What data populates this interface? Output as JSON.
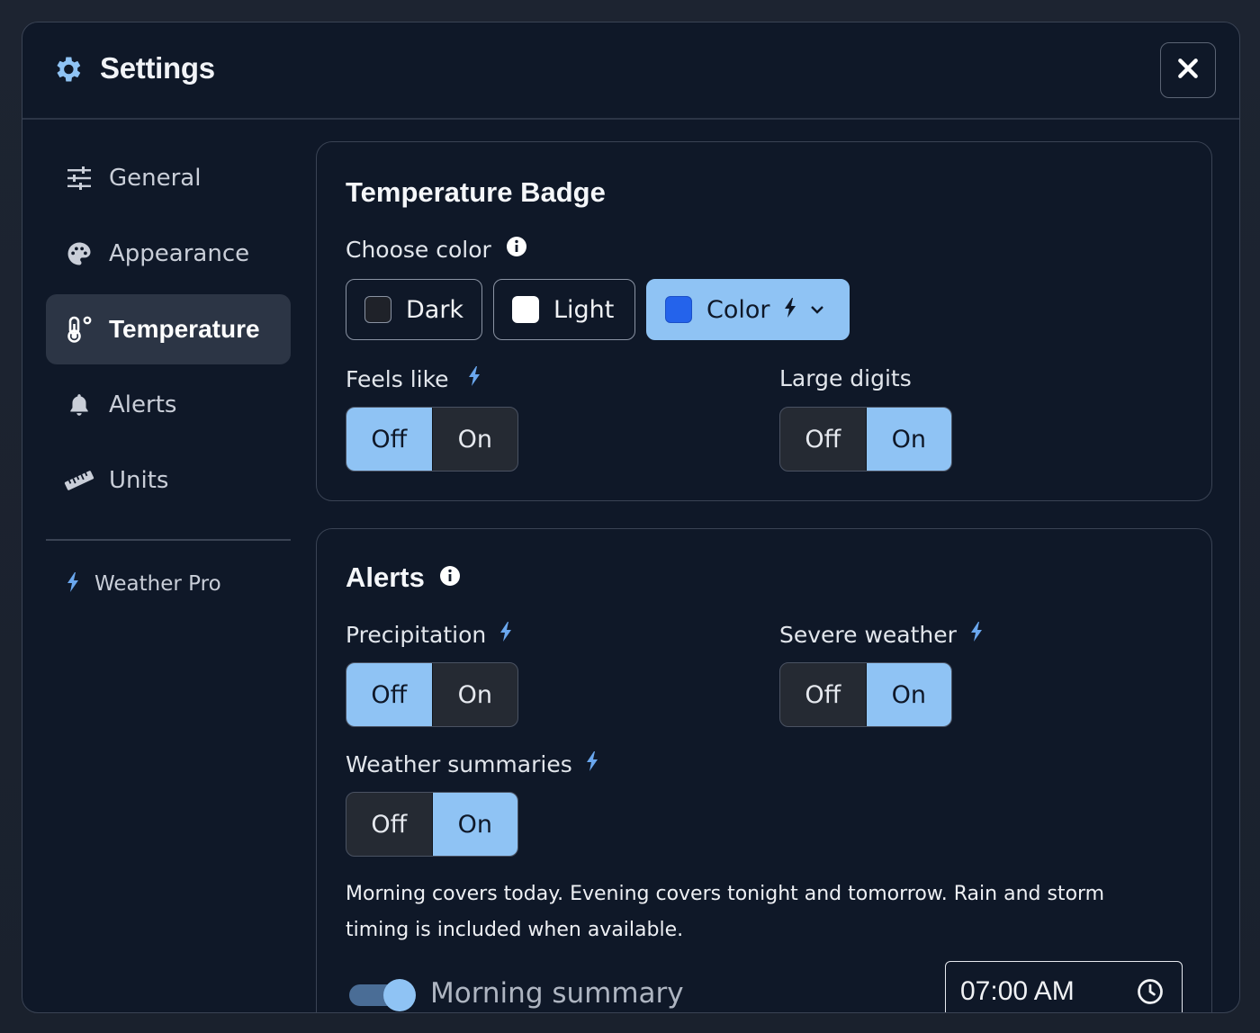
{
  "dialog": {
    "title": "Settings",
    "close_icon": "close-icon",
    "gear_icon": "gear-icon"
  },
  "sidebar": {
    "items": [
      {
        "label": "General",
        "icon": "sliders-icon",
        "active": false
      },
      {
        "label": "Appearance",
        "icon": "palette-icon",
        "active": false
      },
      {
        "label": "Temperature",
        "icon": "thermometer-icon",
        "active": true
      },
      {
        "label": "Alerts",
        "icon": "bell-icon",
        "active": false
      },
      {
        "label": "Units",
        "icon": "ruler-icon",
        "active": false
      }
    ],
    "pro": {
      "label": "Weather Pro",
      "icon": "bolt-icon"
    }
  },
  "badge_card": {
    "title": "Temperature Badge",
    "choose_color_label": "Choose color",
    "color_options": [
      {
        "label": "Dark",
        "swatch": "#1f2229",
        "selected": false
      },
      {
        "label": "Light",
        "swatch": "#ffffff",
        "selected": false
      },
      {
        "label": "Color",
        "swatch": "#2463eb",
        "selected": true
      }
    ],
    "feels_like": {
      "label": "Feels like",
      "off": "Off",
      "on": "On",
      "value": "Off"
    },
    "large_digits": {
      "label": "Large digits",
      "off": "Off",
      "on": "On",
      "value": "On"
    }
  },
  "alerts_card": {
    "title": "Alerts",
    "precipitation": {
      "label": "Precipitation",
      "off": "Off",
      "on": "On",
      "value": "Off"
    },
    "severe_weather": {
      "label": "Severe weather",
      "off": "Off",
      "on": "On",
      "value": "On"
    },
    "weather_summaries": {
      "label": "Weather summaries",
      "off": "Off",
      "on": "On",
      "value": "On"
    },
    "description": "Morning covers today. Evening covers tonight and tomorrow. Rain and storm timing is included when available.",
    "morning_summary": {
      "label": "Morning summary",
      "enabled": true,
      "time": "07:00 AM"
    }
  },
  "colors": {
    "accent": "#8fc3f4",
    "bolt": "#6aa7ee",
    "panel": "#0f1828"
  }
}
